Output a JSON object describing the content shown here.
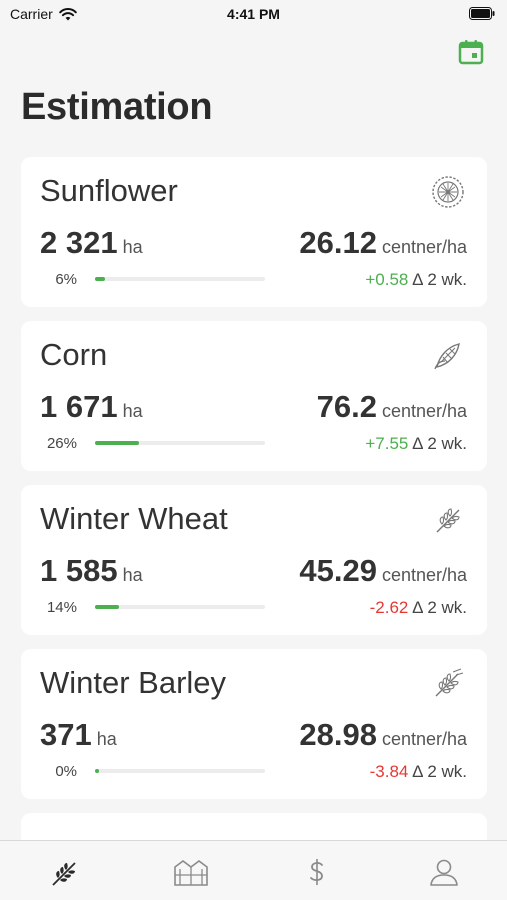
{
  "status_bar": {
    "carrier": "Carrier",
    "time": "4:41 PM"
  },
  "page": {
    "title": "Estimation"
  },
  "colors": {
    "accent": "#4caf50",
    "negative": "#e53935"
  },
  "crops": [
    {
      "name": "Sunflower",
      "icon": "sunflower-icon",
      "area": "2 321",
      "area_unit": "ha",
      "percent": "6%",
      "progress": 0.06,
      "yield": "26.12",
      "yield_unit": "centner/ha",
      "delta": "+0.58",
      "delta_sign": "pos",
      "delta_period": "Δ 2 wk."
    },
    {
      "name": "Corn",
      "icon": "corn-icon",
      "area": "1 671",
      "area_unit": "ha",
      "percent": "26%",
      "progress": 0.26,
      "yield": "76.2",
      "yield_unit": "centner/ha",
      "delta": "+7.55",
      "delta_sign": "pos",
      "delta_period": "Δ 2 wk."
    },
    {
      "name": "Winter Wheat",
      "icon": "wheat-icon",
      "area": "1 585",
      "area_unit": "ha",
      "percent": "14%",
      "progress": 0.14,
      "yield": "45.29",
      "yield_unit": "centner/ha",
      "delta": "-2.62",
      "delta_sign": "neg",
      "delta_period": "Δ 2 wk."
    },
    {
      "name": "Winter Barley",
      "icon": "barley-icon",
      "area": "371",
      "area_unit": "ha",
      "percent": "0%",
      "progress": 0.0,
      "yield": "28.98",
      "yield_unit": "centner/ha",
      "delta": "-3.84",
      "delta_sign": "neg",
      "delta_period": "Δ 2 wk."
    }
  ],
  "tab_bar": {
    "tabs": [
      {
        "icon": "crops-tab-icon",
        "active": true
      },
      {
        "icon": "warehouse-tab-icon",
        "active": false
      },
      {
        "icon": "dollar-tab-icon",
        "active": false
      },
      {
        "icon": "profile-tab-icon",
        "active": false
      }
    ]
  }
}
